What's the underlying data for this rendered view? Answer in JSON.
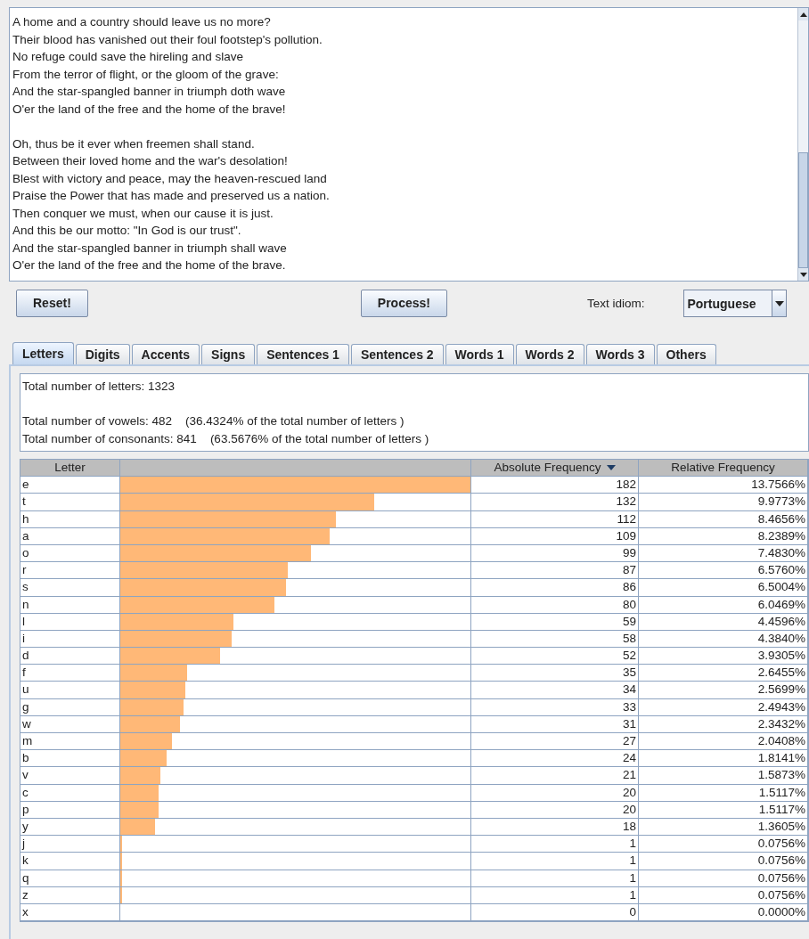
{
  "text_area": {
    "stanzas": [
      [
        "A home and a country should leave us no more?",
        "Their blood has vanished out their foul footstep's pollution.",
        "No refuge could save the hireling and slave",
        "From the terror of flight, or the gloom of the grave:",
        "And the star-spangled banner in triumph doth wave",
        "O'er the land of the free and the home of the brave!"
      ],
      [
        "Oh, thus be it ever when freemen shall stand.",
        "Between their loved home and the war's desolation!",
        "Blest with victory and peace, may the heaven-rescued land",
        "Praise the Power that has made and preserved us a nation.",
        "Then conquer we must, when our cause it is just.",
        "And this be our motto: \"In God is our trust\".",
        "And the star-spangled banner in triumph shall wave",
        "O'er the land of the free and the home of the brave."
      ]
    ]
  },
  "buttons": {
    "reset": "Reset!",
    "process": "Process!"
  },
  "idiom": {
    "label": "Text idiom:",
    "value": "Portuguese"
  },
  "tabs": [
    {
      "label": "Letters",
      "selected": true
    },
    {
      "label": "Digits",
      "selected": false
    },
    {
      "label": "Accents",
      "selected": false
    },
    {
      "label": "Signs",
      "selected": false
    },
    {
      "label": "Sentences 1",
      "selected": false
    },
    {
      "label": "Sentences 2",
      "selected": false
    },
    {
      "label": "Words 1",
      "selected": false
    },
    {
      "label": "Words 2",
      "selected": false
    },
    {
      "label": "Words 3",
      "selected": false
    },
    {
      "label": "Others",
      "selected": false
    }
  ],
  "summary": [
    [
      "Total number of letters: 1323"
    ],
    [
      "Total number of vowels: 482    (36.4324% of the total number of letters )",
      "Total number of consonants: 841    (63.5676% of the total number of letters )"
    ]
  ],
  "table": {
    "columns": [
      {
        "label": "Letter",
        "sorted": false
      },
      {
        "sorted": false
      },
      {
        "label": "Absolute Frequency",
        "sorted": true
      },
      {
        "label": "Relative Frequency",
        "sorted": false
      }
    ],
    "rows": [
      {
        "letter": "e",
        "level": 1,
        "absolute": "182",
        "relative": "13.7566%"
      },
      {
        "letter": "t",
        "level": 0.725,
        "absolute": "132",
        "relative": "9.9773%"
      },
      {
        "letter": "h",
        "level": 0.615,
        "absolute": "112",
        "relative": "8.4656%"
      },
      {
        "letter": "a",
        "level": 0.599,
        "absolute": "109",
        "relative": "8.2389%"
      },
      {
        "letter": "o",
        "level": 0.544,
        "absolute": "99",
        "relative": "7.4830%"
      },
      {
        "letter": "r",
        "level": 0.478,
        "absolute": "87",
        "relative": "6.5760%"
      },
      {
        "letter": "s",
        "level": 0.473,
        "absolute": "86",
        "relative": "6.5004%"
      },
      {
        "letter": "n",
        "level": 0.44,
        "absolute": "80",
        "relative": "6.0469%"
      },
      {
        "letter": "l",
        "level": 0.324,
        "absolute": "59",
        "relative": "4.4596%"
      },
      {
        "letter": "i",
        "level": 0.319,
        "absolute": "58",
        "relative": "4.3840%"
      },
      {
        "letter": "d",
        "level": 0.286,
        "absolute": "52",
        "relative": "3.9305%"
      },
      {
        "letter": "f",
        "level": 0.192,
        "absolute": "35",
        "relative": "2.6455%"
      },
      {
        "letter": "u",
        "level": 0.187,
        "absolute": "34",
        "relative": "2.5699%"
      },
      {
        "letter": "g",
        "level": 0.181,
        "absolute": "33",
        "relative": "2.4943%"
      },
      {
        "letter": "w",
        "level": 0.17,
        "absolute": "31",
        "relative": "2.3432%"
      },
      {
        "letter": "m",
        "level": 0.148,
        "absolute": "27",
        "relative": "2.0408%"
      },
      {
        "letter": "b",
        "level": 0.132,
        "absolute": "24",
        "relative": "1.8141%"
      },
      {
        "letter": "v",
        "level": 0.115,
        "absolute": "21",
        "relative": "1.5873%"
      },
      {
        "letter": "c",
        "level": 0.11,
        "absolute": "20",
        "relative": "1.5117%"
      },
      {
        "letter": "p",
        "level": 0.11,
        "absolute": "20",
        "relative": "1.5117%"
      },
      {
        "letter": "y",
        "level": 0.099,
        "absolute": "18",
        "relative": "1.3605%"
      },
      {
        "letter": "j",
        "level": 0.005,
        "absolute": "1",
        "relative": "0.0756%"
      },
      {
        "letter": "k",
        "level": 0.005,
        "absolute": "1",
        "relative": "0.0756%"
      },
      {
        "letter": "q",
        "level": 0.005,
        "absolute": "1",
        "relative": "0.0756%"
      },
      {
        "letter": "z",
        "level": 0.005,
        "absolute": "1",
        "relative": "0.0756%"
      },
      {
        "letter": "x",
        "absolute": "0",
        "relative": "0.0000%"
      }
    ]
  }
}
